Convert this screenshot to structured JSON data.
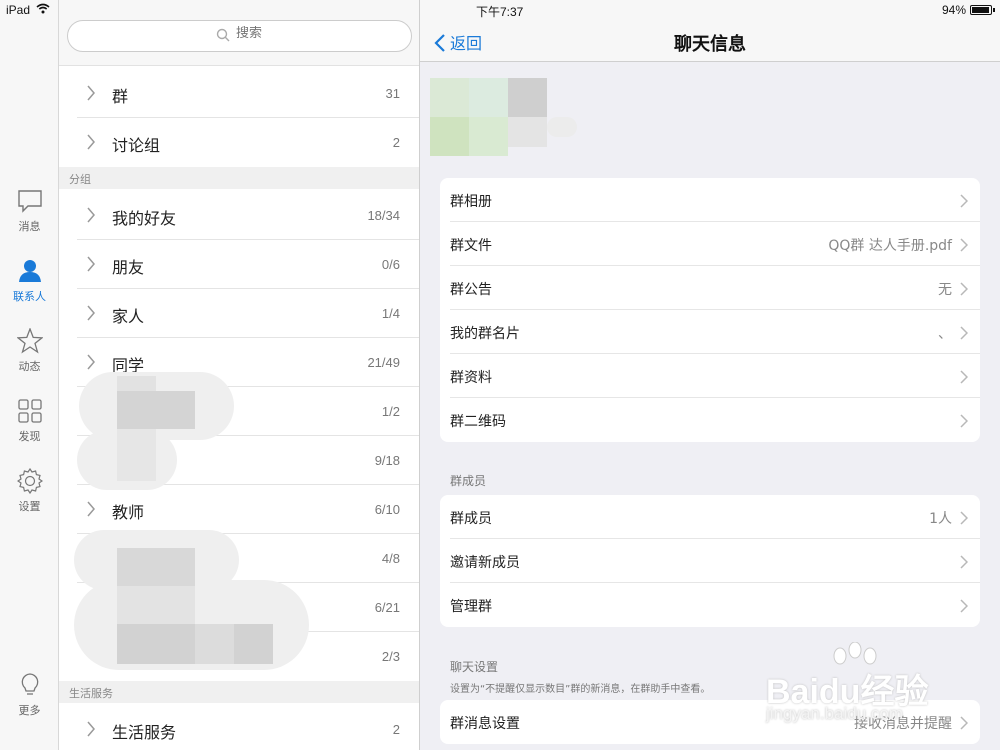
{
  "status_bar": {
    "device": "iPad",
    "time": "下午7:37",
    "battery": "94%",
    "battery_level": 0.94
  },
  "tab_rail": {
    "items": [
      {
        "label": "消息",
        "icon": "chat-bubble-icon",
        "active": false
      },
      {
        "label": "联系人",
        "icon": "person-icon",
        "active": true
      },
      {
        "label": "动态",
        "icon": "star-icon",
        "active": false
      },
      {
        "label": "发现",
        "icon": "grid-icon",
        "active": false
      },
      {
        "label": "设置",
        "icon": "gear-icon",
        "active": false
      },
      {
        "label": "更多",
        "icon": "lightbulb-icon",
        "active": false
      }
    ]
  },
  "contacts": {
    "search_placeholder": "搜索",
    "top_rows": [
      {
        "name": "群",
        "count": "31"
      },
      {
        "name": "讨论组",
        "count": "2"
      }
    ],
    "section_groups": "分组",
    "group_rows": [
      {
        "name": "我的好友",
        "count": "18/34"
      },
      {
        "name": "朋友",
        "count": "0/6"
      },
      {
        "name": "家人",
        "count": "1/4"
      },
      {
        "name": "同学",
        "count": "21/49"
      },
      {
        "name": "",
        "count": "1/2"
      },
      {
        "name": "",
        "count": "9/18"
      },
      {
        "name": "教师",
        "count": "6/10"
      },
      {
        "name": "",
        "count": "4/8"
      },
      {
        "name": "",
        "count": "6/21"
      },
      {
        "name": "",
        "count": "2/3"
      }
    ],
    "section_services": "生活服务",
    "service_rows": [
      {
        "name": "生活服务",
        "count": "2"
      }
    ]
  },
  "detail": {
    "back_label": "返回",
    "title": "聊天信息",
    "group1": [
      {
        "label": "群相册",
        "value": ""
      },
      {
        "label": "群文件",
        "value": "QQ群 达人手册.pdf"
      },
      {
        "label": "群公告",
        "value": "无"
      },
      {
        "label": "我的群名片",
        "value": "、"
      },
      {
        "label": "群资料",
        "value": ""
      },
      {
        "label": "群二维码",
        "value": ""
      }
    ],
    "members_section": "群成员",
    "group2": [
      {
        "label": "群成员",
        "value": "1人"
      },
      {
        "label": "邀请新成员",
        "value": ""
      },
      {
        "label": "管理群",
        "value": ""
      }
    ],
    "chat_section": "聊天设置",
    "chat_note": "设置为“不提醒仅显示数目”群的新消息，在群助手中查看。",
    "group3": [
      {
        "label": "群消息设置",
        "value": "接收消息并提醒"
      }
    ]
  },
  "watermark": {
    "brand": "Baidu经验",
    "url": "jingyan.baidu.com"
  },
  "colors": {
    "accent": "#1a7ad8",
    "panel_bg": "#efeff4"
  }
}
